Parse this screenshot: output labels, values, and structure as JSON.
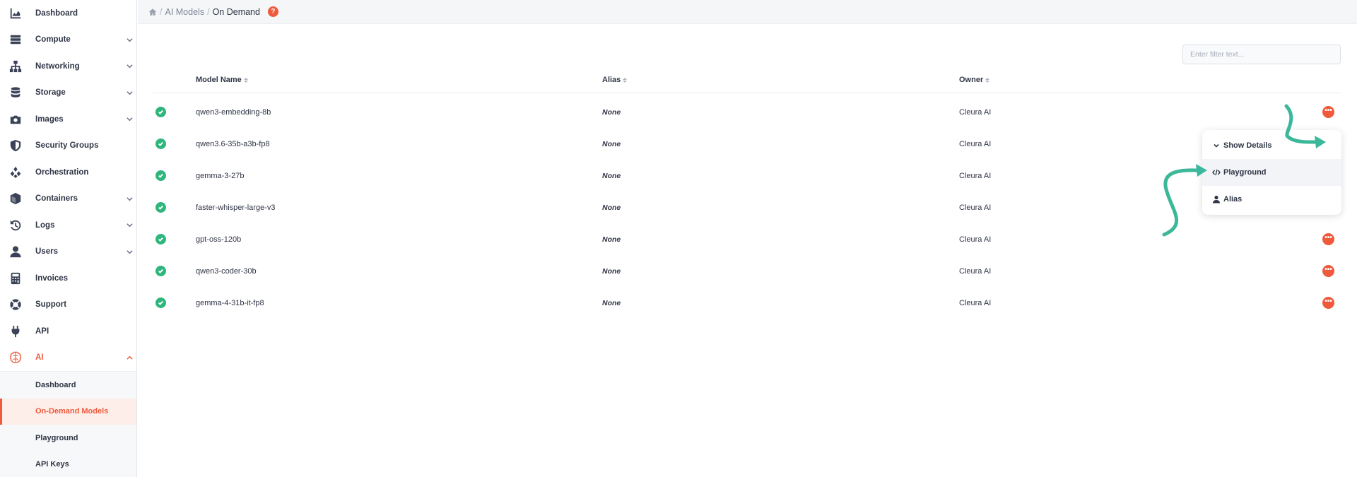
{
  "sidebar": {
    "items": [
      {
        "label": "Dashboard",
        "icon": "chart-area-icon",
        "expandable": false
      },
      {
        "label": "Compute",
        "icon": "server-icon",
        "expandable": true
      },
      {
        "label": "Networking",
        "icon": "sitemap-icon",
        "expandable": true
      },
      {
        "label": "Storage",
        "icon": "database-icon",
        "expandable": true
      },
      {
        "label": "Images",
        "icon": "camera-icon",
        "expandable": true
      },
      {
        "label": "Security Groups",
        "icon": "shield-icon",
        "expandable": false
      },
      {
        "label": "Orchestration",
        "icon": "layers-icon",
        "expandable": false
      },
      {
        "label": "Containers",
        "icon": "cube-icon",
        "expandable": true
      },
      {
        "label": "Logs",
        "icon": "history-icon",
        "expandable": true
      },
      {
        "label": "Users",
        "icon": "user-icon",
        "expandable": true
      },
      {
        "label": "Invoices",
        "icon": "calculator-icon",
        "expandable": false
      },
      {
        "label": "Support",
        "icon": "lifebuoy-icon",
        "expandable": false
      },
      {
        "label": "API",
        "icon": "plug-icon",
        "expandable": false
      },
      {
        "label": "AI",
        "icon": "brain-icon",
        "expandable": true,
        "expanded": true
      }
    ],
    "ai_submenu": [
      {
        "label": "Dashboard"
      },
      {
        "label": "On-Demand Models",
        "selected": true
      },
      {
        "label": "Playground"
      },
      {
        "label": "API Keys"
      }
    ]
  },
  "breadcrumb": {
    "home_icon": "home-icon",
    "items": [
      "AI Models",
      "On Demand"
    ],
    "separator": "/",
    "help_label": "?"
  },
  "filter": {
    "placeholder": "Enter filter text...",
    "value": ""
  },
  "table": {
    "columns": [
      "Model Name",
      "Alias",
      "Owner"
    ],
    "rows": [
      {
        "name": "qwen3-embedding-8b",
        "alias": "None",
        "owner": "Cleura AI"
      },
      {
        "name": "qwen3.6-35b-a3b-fp8",
        "alias": "None",
        "owner": "Cleura AI"
      },
      {
        "name": "gemma-3-27b",
        "alias": "None",
        "owner": "Cleura AI"
      },
      {
        "name": "faster-whisper-large-v3",
        "alias": "None",
        "owner": "Cleura AI"
      },
      {
        "name": "gpt-oss-120b",
        "alias": "None",
        "owner": "Cleura AI"
      },
      {
        "name": "qwen3-coder-30b",
        "alias": "None",
        "owner": "Cleura AI"
      },
      {
        "name": "gemma-4-31b-it-fp8",
        "alias": "None",
        "owner": "Cleura AI"
      }
    ]
  },
  "dropdown": {
    "items": [
      {
        "label": "Show Details",
        "icon": "chevron-down-icon"
      },
      {
        "label": "Playground",
        "icon": "code-icon"
      },
      {
        "label": "Alias",
        "icon": "user-icon"
      }
    ]
  },
  "colors": {
    "accent": "#ef5a3c",
    "status_ok": "#2eb67d",
    "annotation": "#3bb89a"
  },
  "more_label": "•••"
}
